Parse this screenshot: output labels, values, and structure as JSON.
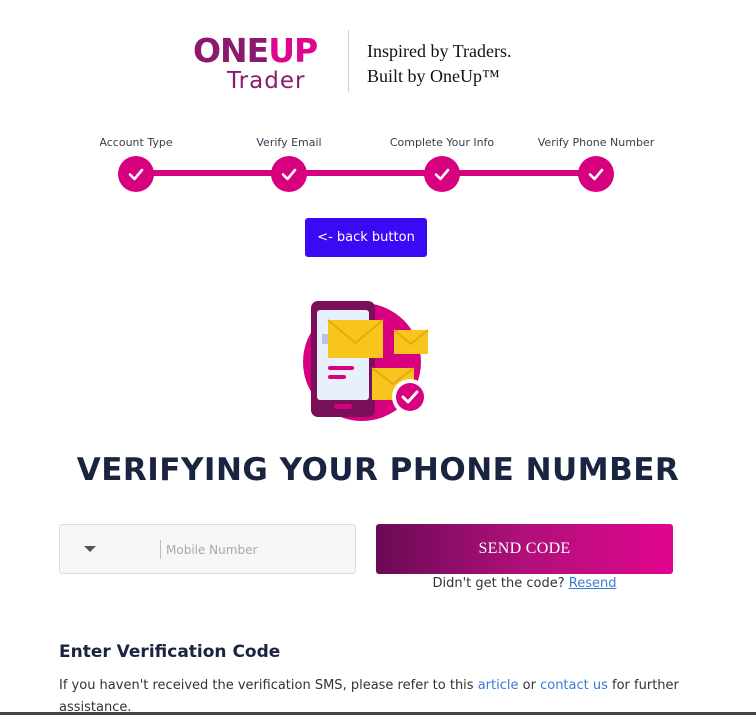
{
  "logo": {
    "one": "ONE",
    "up": "UP",
    "trader": "Trader"
  },
  "tagline": {
    "line1": "Inspired by Traders.",
    "line2": "Built by OneUp™"
  },
  "steps": [
    {
      "label": "Account Type",
      "done": true
    },
    {
      "label": "Verify Email",
      "done": true
    },
    {
      "label": "Complete Your Info",
      "done": true
    },
    {
      "label": "Verify Phone Number",
      "done": true
    }
  ],
  "back_button": {
    "label": "<- back button"
  },
  "title": "VERIFYING YOUR PHONE NUMBER",
  "phone": {
    "placeholder": "Mobile Number",
    "value": ""
  },
  "send_button": {
    "label": "SEND CODE"
  },
  "resend": {
    "prompt": "Didn't get the code?",
    "link": "Resend"
  },
  "verification": {
    "title": "Enter Verification Code",
    "text_before": "If you haven't received the verification SMS, please refer to this",
    "article_link": "article",
    "or": "or",
    "contact_link": "contact us",
    "text_after": "for further assistance."
  },
  "colors": {
    "brand": "#d7007f",
    "brand_dark": "#8b1a6e",
    "back_button": "#3b0af5",
    "link": "#3a7bd5"
  },
  "icons": [
    "check-icon",
    "caret-down-icon",
    "phone-envelope-illustration"
  ]
}
